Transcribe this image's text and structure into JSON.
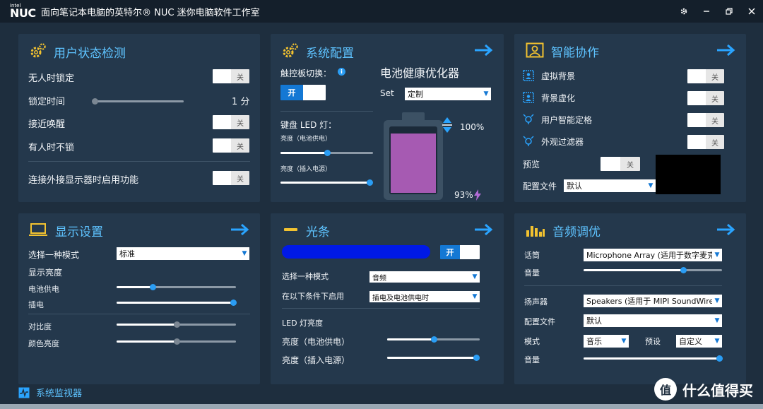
{
  "app": {
    "logo_top": "intel",
    "logo_main": "NUC",
    "title": "面向笔记本电脑的英特尔® NUC 迷你电脑软件工作室"
  },
  "user_status": {
    "title": "用户状态检测",
    "lock_when_absent": {
      "label": "无人时锁定",
      "toggle": "关"
    },
    "lock_time": {
      "label": "锁定时间",
      "value": "1 分",
      "level": 0.0
    },
    "approach_wake": {
      "label": "接近唤醒",
      "toggle": "关"
    },
    "no_lock_present": {
      "label": "有人时不锁",
      "toggle": "关"
    },
    "external_display": {
      "label": "连接外接显示器时启用功能",
      "toggle": "关"
    }
  },
  "system_config": {
    "title": "系统配置",
    "touchpad_label": "触控板切换：",
    "touchpad_toggle": "开",
    "kb_led_label": "键盘 LED 灯：",
    "brightness_battery_label": "亮度（电池供电）",
    "brightness_battery_level": 0.5,
    "brightness_plugged_label": "亮度（插入电源）",
    "brightness_plugged_level": 1.0,
    "battery_title": "电池健康优化器",
    "set_label": "Set",
    "set_value": "定制",
    "charge_limit": "100%",
    "battery_level": "93%",
    "battery_fill_level": 0.93
  },
  "smart_collab": {
    "title": "智能协作",
    "virtual_bg": {
      "label": "虚拟背景",
      "toggle": "关"
    },
    "bg_blur": {
      "label": "背景虚化",
      "toggle": "关"
    },
    "auto_frame": {
      "label": "用户智能定格",
      "toggle": "关"
    },
    "appearance_filter": {
      "label": "外观过滤器",
      "toggle": "关"
    },
    "preview": {
      "label": "预览",
      "toggle": "关"
    },
    "profile": {
      "label": "配置文件",
      "value": "默认"
    }
  },
  "display": {
    "title": "显示设置",
    "mode_label": "选择一种模式",
    "mode_value": "标准",
    "brightness_label": "显示亮度",
    "battery_label": "电池供电",
    "battery_level": 0.3,
    "plugged_label": "插电",
    "plugged_level": 1.0,
    "contrast_label": "对比度",
    "contrast_level": 0.5,
    "color_label": "颜色亮度",
    "color_level": 0.5
  },
  "light_bar": {
    "title": "光条",
    "color": "#0019e6",
    "toggle": "开",
    "mode_label": "选择一种模式",
    "mode_value": "音频",
    "condition_label": "在以下条件下启用",
    "condition_value": "插电及电池供电时",
    "led_label": "LED 灯亮度",
    "battery_label": "亮度（电池供电）",
    "battery_level": 0.5,
    "plugged_label": "亮度（插入电源）",
    "plugged_level": 1.0
  },
  "audio": {
    "title": "音频调优",
    "mic_label": "话筒",
    "mic_value": "Microphone Array (适用于数字麦克风",
    "mic_volume_label": "音量",
    "mic_volume_level": 0.72,
    "speaker_label": "扬声器",
    "speaker_value": "Speakers (适用于 MIPI SoundWire",
    "profile_label": "配置文件",
    "profile_value": "默认",
    "mode_label": "模式",
    "mode_value": "音乐",
    "preset_label": "预设",
    "preset_value": "自定义",
    "speaker_volume_label": "音量",
    "speaker_volume_level": 1.0
  },
  "footer": {
    "system_monitor": "系统监视器",
    "watermark": "什么值得买",
    "watermark_logo": "值"
  },
  "colors": {
    "accent": "#5ec3ff",
    "icon_yellow": "#f2c230",
    "toggle_on": "#1478d4",
    "card_bg": "#24384c"
  }
}
